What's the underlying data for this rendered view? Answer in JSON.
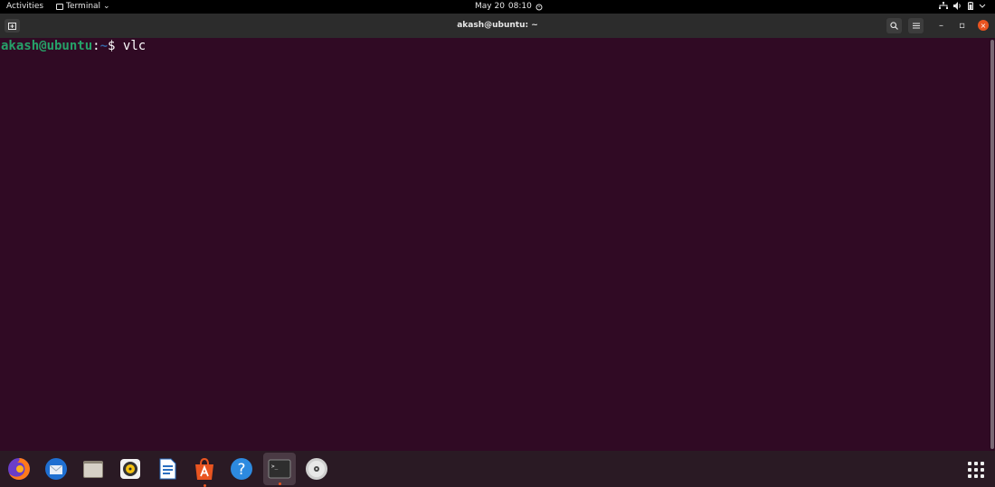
{
  "topbar": {
    "activities": "Activities",
    "app_name": "Terminal",
    "app_menu_arrow": "⌄",
    "date": "May 20",
    "time": "08:10",
    "status_icons": [
      "network-icon",
      "volume-icon",
      "battery-icon",
      "system-menu-chevron-icon"
    ]
  },
  "window": {
    "title": "akash@ubuntu: ~",
    "buttons": {
      "search": "search-icon",
      "menu": "hamburger-icon",
      "minimize": "–",
      "maximize": "▫",
      "close": "×"
    }
  },
  "terminal": {
    "prompt_user": "akash@ubuntu",
    "prompt_sep": ":",
    "prompt_path": "~",
    "prompt_symbol": "$ ",
    "command": "vlc"
  },
  "dock": {
    "items": [
      {
        "name": "firefox-icon"
      },
      {
        "name": "thunderbird-icon"
      },
      {
        "name": "files-icon"
      },
      {
        "name": "rhythmbox-icon"
      },
      {
        "name": "libreoffice-writer-icon"
      },
      {
        "name": "ubuntu-software-icon",
        "running": true
      },
      {
        "name": "help-icon",
        "glyph": "?"
      },
      {
        "name": "terminal-icon",
        "running": true,
        "active": true,
        "glyph": ">_"
      },
      {
        "name": "dvd-icon"
      }
    ],
    "show_apps": "show-applications-icon"
  },
  "colors": {
    "terminal_bg": "#300a24",
    "prompt_user": "#26a269",
    "prompt_path": "#3465a4",
    "accent": "#e95420"
  }
}
